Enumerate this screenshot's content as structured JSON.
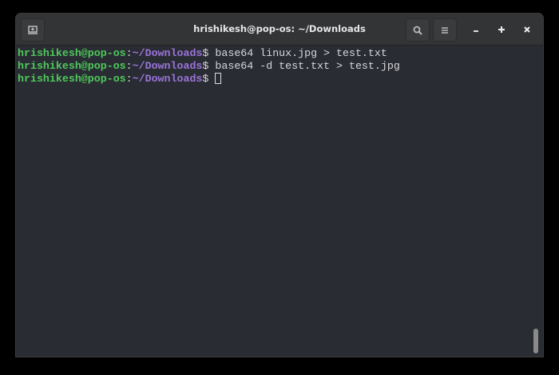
{
  "window": {
    "title": "hrishikesh@pop-os: ~/Downloads"
  },
  "terminal": {
    "lines": [
      {
        "user": "hrishikesh@pop-os",
        "sep": ":",
        "path": "~/Downloads",
        "prompt": "$ ",
        "command": "base64 linux.jpg > test.txt"
      },
      {
        "user": "hrishikesh@pop-os",
        "sep": ":",
        "path": "~/Downloads",
        "prompt": "$ ",
        "command": "base64 -d test.txt > test.jpg"
      },
      {
        "user": "hrishikesh@pop-os",
        "sep": ":",
        "path": "~/Downloads",
        "prompt": "$ ",
        "command": ""
      }
    ]
  },
  "colors": {
    "user": "#4ec95a",
    "path": "#9a74d8",
    "background": "#2a2c34"
  }
}
